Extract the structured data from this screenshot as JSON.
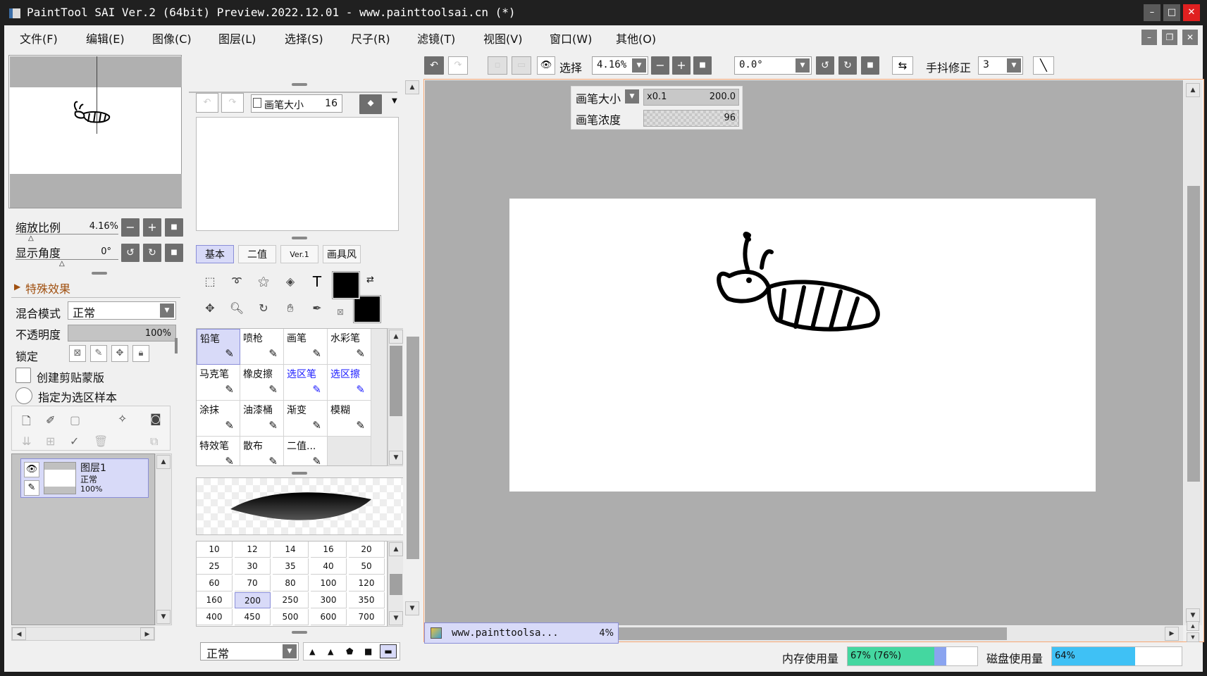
{
  "window": {
    "title": "PaintTool SAI Ver.2 (64bit) Preview.2022.12.01 - www.painttoolsai.cn (*)"
  },
  "menu": [
    "文件(F)",
    "编辑(E)",
    "图像(C)",
    "图层(L)",
    "选择(S)",
    "尺子(R)",
    "滤镜(T)",
    "视图(V)",
    "窗口(W)",
    "其他(O)"
  ],
  "navigator": {
    "zoom_label": "缩放比例",
    "zoom_value": "4.16%",
    "angle_label": "显示角度",
    "angle_value": "0°"
  },
  "layer_props": {
    "effects_label": "特殊效果",
    "blend_label": "混合模式",
    "blend_value": "正常",
    "opacity_label": "不透明度",
    "opacity_value": "100%",
    "opacity_fraction": 1.0,
    "lock_label": "锁定",
    "clip_label": "创建剪贴蒙版",
    "sample_label": "指定为选区样本"
  },
  "layers": [
    {
      "name": "图层1",
      "mode": "正常",
      "opacity": "100%"
    }
  ],
  "brush_panel": {
    "size_label": "画笔大小",
    "size_value": "16"
  },
  "tool_tabs": [
    {
      "label": "基本",
      "selected": true
    },
    {
      "label": "二值",
      "selected": false
    },
    {
      "label": "Ver.1",
      "selected": false
    },
    {
      "label": "画具风",
      "selected": false
    }
  ],
  "tools": [
    {
      "label": "铅笔",
      "icon": "pencil-icon",
      "selected": true
    },
    {
      "label": "喷枪",
      "icon": "airbrush-icon"
    },
    {
      "label": "画笔",
      "icon": "brush-icon"
    },
    {
      "label": "水彩笔",
      "icon": "watercolor-icon"
    },
    {
      "label": "马克笔",
      "icon": "marker-icon"
    },
    {
      "label": "橡皮擦",
      "icon": "eraser-icon"
    },
    {
      "label": "选区笔",
      "icon": "selection-pen-icon",
      "blue": true
    },
    {
      "label": "选区擦",
      "icon": "selection-eraser-icon",
      "blue": true
    },
    {
      "label": "涂抹",
      "icon": "smudge-icon"
    },
    {
      "label": "油漆桶",
      "icon": "bucket-icon"
    },
    {
      "label": "渐变",
      "icon": "gradient-icon"
    },
    {
      "label": "模糊",
      "icon": "blur-icon"
    },
    {
      "label": "特效笔",
      "icon": "effect-pen-icon"
    },
    {
      "label": "散布",
      "icon": "scatter-icon"
    },
    {
      "label": "二值...",
      "icon": "binary-icon"
    }
  ],
  "brush_sizes": [
    "10",
    "12",
    "14",
    "16",
    "20",
    "25",
    "30",
    "35",
    "40",
    "50",
    "60",
    "70",
    "80",
    "100",
    "120",
    "160",
    "200",
    "250",
    "300",
    "350",
    "400",
    "450",
    "500",
    "600",
    "700"
  ],
  "brush_size_selected": "200",
  "brush_mode": "正常",
  "canvas_toolbar": {
    "select_label": "选择",
    "zoom": "4.16%",
    "angle": "0.0°",
    "stabilizer_label": "手抖修正",
    "stabilizer_value": "3"
  },
  "brush_overlay": {
    "size_label": "画笔大小",
    "size_mult": "x0.1",
    "size_value": "200.0",
    "density_label": "画笔浓度",
    "density_value": "96"
  },
  "document_tab": {
    "name": "www.painttoolsa...",
    "zoom": "4%"
  },
  "status": {
    "mem_label": "内存使用量",
    "mem_value": "67% (76%)",
    "mem_fraction": 0.67,
    "mem_peak_fraction": 0.76,
    "disk_label": "磁盘使用量",
    "disk_value": "64%",
    "disk_fraction": 0.64
  },
  "colors": {
    "accent": "#d8daf8",
    "highlight": "#f7a774",
    "mem_bar": "#44d7a0",
    "disk_bar": "#3fc1f5",
    "fg_color": "#000000",
    "bg_color": "#000000"
  }
}
